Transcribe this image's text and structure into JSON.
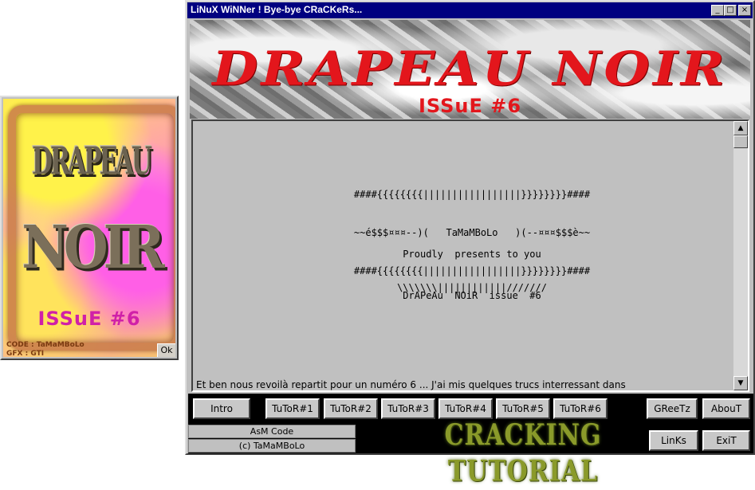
{
  "splash": {
    "title_line1": "DRAPEAU",
    "title_line2": "NOIR",
    "issue": "ISSuE #6",
    "credits_code": "CODE : TaMaMBoLo",
    "credits_gfx": "GFX : GTI",
    "ok_label": "Ok"
  },
  "window": {
    "title": "LiNuX WiNNer ! Bye-bye CRaCKeRs...",
    "minimize_glyph": "_",
    "maximize_glyph": "□",
    "close_glyph": "×"
  },
  "banner": {
    "title": "DRAPEAU NOIR",
    "issue": "ISSuE #6"
  },
  "text": {
    "ascii_line1": "####{{{{{{{{|||||||||||||||||}}}}}}}}####",
    "ascii_line2": "~~é$$$¤¤¤--)(   TaMaMBoLo   )(--¤¤¤$$$è~~",
    "ascii_line3": "####{{{{{{{{|||||||||||||||||}}}}}}}}####",
    "present_line1": "Proudly  presents to you",
    "present_line2": "\\\\\\\\\\\\\\||||||||||||///////",
    "issue_line": "DrAPeAu  NOiR  issue  #6",
    "body_line": "Et ben nous revoilà repartit pour un numéro 6 ... J'ai mis quelques trucs interressant dans",
    "scroll_up": "▲",
    "scroll_down": "▼"
  },
  "buttons": {
    "intro": "Intro",
    "tutor1": "TuToR#1",
    "tutor2": "TuToR#2",
    "tutor3": "TuToR#3",
    "tutor4": "TuToR#4",
    "tutor5": "TuToR#5",
    "tutor6": "TuToR#6",
    "greetz": "GReeTz",
    "about": "AbouT",
    "links": "LinKs",
    "exit": "ExiT"
  },
  "footer": {
    "asm_code": "AsM Code",
    "copyright": "(c) TaMaMBoLo",
    "logo_text": "CRACKING TUTORIAL"
  },
  "colors": {
    "titlebar": "#000080",
    "banner_red": "#e3161c",
    "splash_pink": "#d020a8",
    "logo_green": "#8a9a2a"
  }
}
